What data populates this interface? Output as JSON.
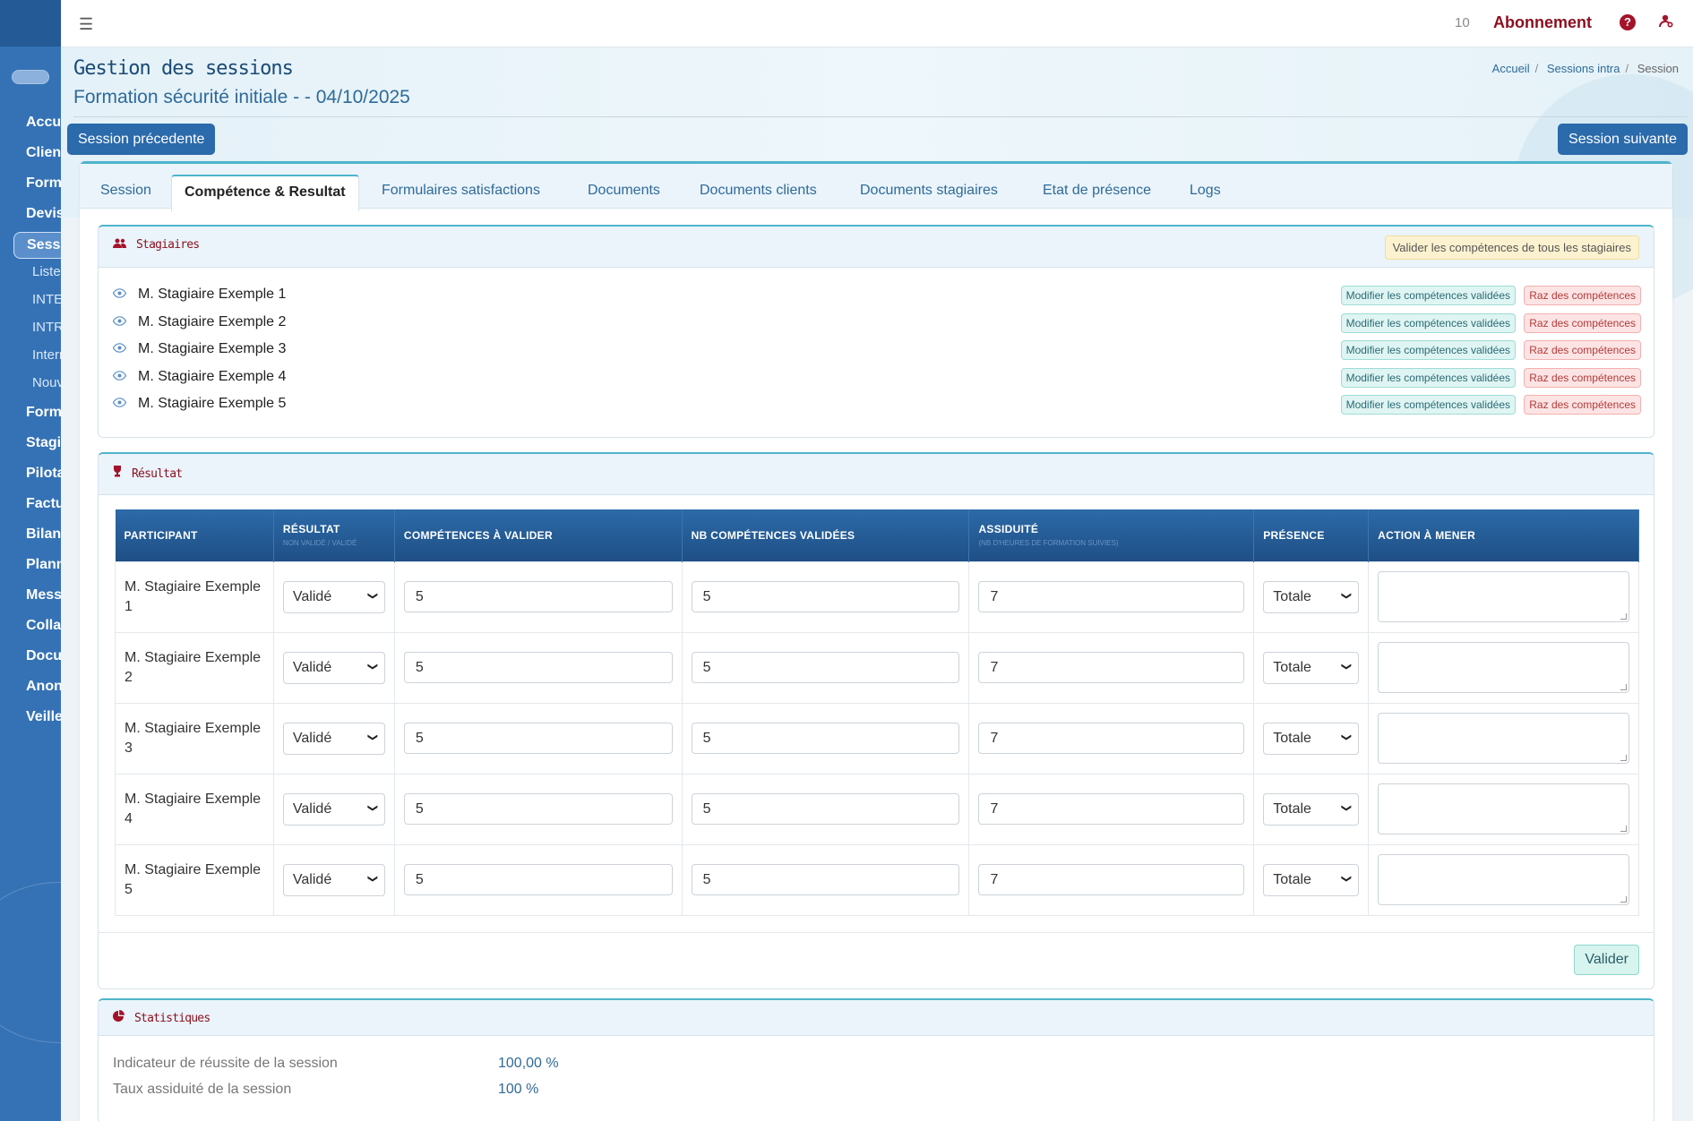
{
  "sidebar": {
    "items": [
      {
        "label": "Accueil",
        "top": 0
      },
      {
        "label": "Clients"
      },
      {
        "label": "Formations"
      },
      {
        "label": "Devis"
      },
      {
        "label": "Sessions"
      },
      {
        "label": "Liste"
      },
      {
        "label": "INTER"
      },
      {
        "label": "INTRA"
      },
      {
        "label": "Internes"
      },
      {
        "label": "Nouvelle"
      },
      {
        "label": "Formateurs"
      },
      {
        "label": "Stagiaires"
      },
      {
        "label": "Pilotage"
      },
      {
        "label": "Factures"
      },
      {
        "label": "Bilan"
      },
      {
        "label": "Planning"
      },
      {
        "label": "Messages"
      },
      {
        "label": "Collaborateurs"
      },
      {
        "label": "Documents"
      },
      {
        "label": "Anonymisation"
      },
      {
        "label": "Veille"
      }
    ]
  },
  "header": {
    "count": "10",
    "subscription": "Abonnement",
    "help_glyph": "?"
  },
  "page": {
    "title": "Gestion des sessions",
    "subtitle": "Formation sécurité initiale - - 04/10/2025",
    "breadcrumb": [
      "Accueil",
      "Sessions intra",
      "Session"
    ],
    "prev_button": "Session précedente",
    "next_button": "Session suivante"
  },
  "tabs": [
    "Session",
    "Compétence & Resultat",
    "Formulaires satisfactions",
    "Documents",
    "Documents clients",
    "Documents stagiaires",
    "Etat de présence",
    "Logs"
  ],
  "stagiaires_panel": {
    "title": "Stagiaires",
    "validate_all": "Valider les compétences de tous les stagiaires",
    "modify_label": "Modifier les compétences validées",
    "reset_label": "Raz des compétences",
    "trainees": [
      "M. Stagiaire Exemple 1",
      "M. Stagiaire Exemple 2",
      "M. Stagiaire Exemple 3",
      "M. Stagiaire Exemple 4",
      "M. Stagiaire Exemple 5"
    ]
  },
  "resultat_panel": {
    "title": "Résultat",
    "columns": [
      {
        "label": "PARTICIPANT",
        "sub": ""
      },
      {
        "label": "RÉSULTAT",
        "sub": "NON VALIDÉ / VALIDÉ"
      },
      {
        "label": "COMPÉTENCES À VALIDER",
        "sub": ""
      },
      {
        "label": "NB COMPÉTENCES VALIDÉES",
        "sub": ""
      },
      {
        "label": "ASSIDUITÉ",
        "sub": "(NB D'HEURES DE FORMATION SUIVIES)"
      },
      {
        "label": "PRÉSENCE",
        "sub": ""
      },
      {
        "label": "ACTION À MENER",
        "sub": ""
      }
    ],
    "rows": [
      {
        "participant": "M. Stagiaire Exemple 1",
        "resultat": "Validé",
        "competences": "5",
        "validees": "5",
        "assiduite": "7",
        "presence": "Totale",
        "action": ""
      },
      {
        "participant": "M. Stagiaire Exemple 2",
        "resultat": "Validé",
        "competences": "5",
        "validees": "5",
        "assiduite": "7",
        "presence": "Totale",
        "action": ""
      },
      {
        "participant": "M. Stagiaire Exemple 3",
        "resultat": "Validé",
        "competences": "5",
        "validees": "5",
        "assiduite": "7",
        "presence": "Totale",
        "action": ""
      },
      {
        "participant": "M. Stagiaire Exemple 4",
        "resultat": "Validé",
        "competences": "5",
        "validees": "5",
        "assiduite": "7",
        "presence": "Totale",
        "action": ""
      },
      {
        "participant": "M. Stagiaire Exemple 5",
        "resultat": "Validé",
        "competences": "5",
        "validees": "5",
        "assiduite": "7",
        "presence": "Totale",
        "action": ""
      }
    ],
    "submit": "Valider"
  },
  "stats_panel": {
    "title": "Statistiques",
    "rows": [
      {
        "label": "Indicateur de réussite de la session",
        "value": "100,00 %"
      },
      {
        "label": "Taux assiduité de la session",
        "value": "100 %"
      }
    ]
  },
  "colors": {
    "primary": "#2b6aab",
    "accent": "#8b0f1f",
    "teal": "#4eb4cc"
  }
}
